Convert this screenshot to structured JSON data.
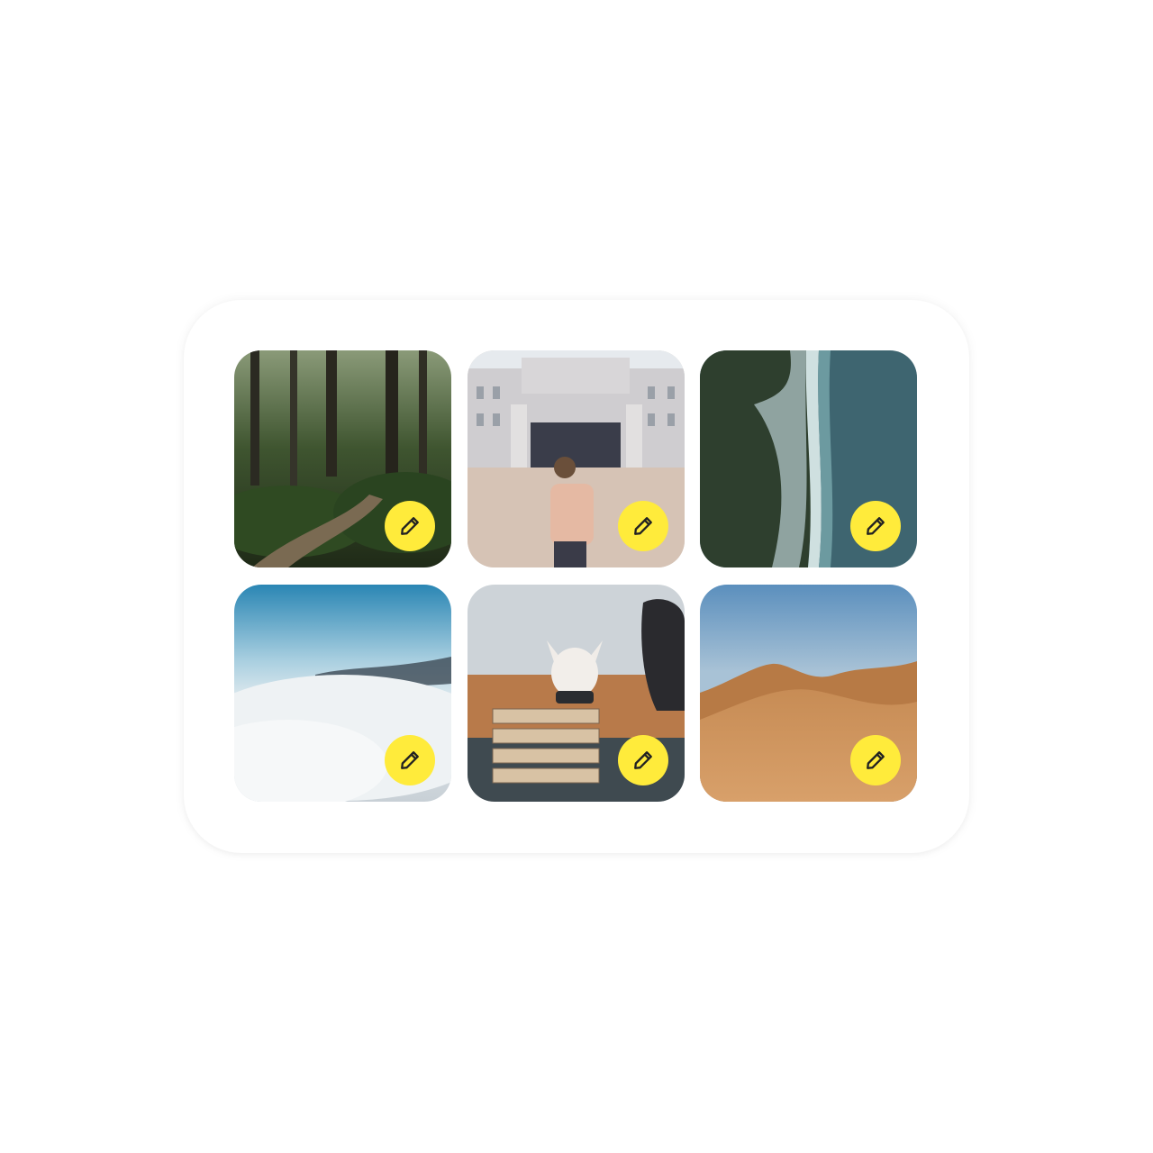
{
  "colors": {
    "edit_button_bg": "#FFEB3B",
    "edit_icon_stroke": "#222222",
    "card_bg": "#FFFFFF"
  },
  "gallery": {
    "tiles": [
      {
        "subject": "forest-trail",
        "edit_icon": "pencil-icon"
      },
      {
        "subject": "palace-visitor",
        "edit_icon": "pencil-icon"
      },
      {
        "subject": "aerial-coastline",
        "edit_icon": "pencil-icon"
      },
      {
        "subject": "sea-of-clouds",
        "edit_icon": "pencil-icon"
      },
      {
        "subject": "dog-in-basket",
        "edit_icon": "pencil-icon"
      },
      {
        "subject": "desert-dunes",
        "edit_icon": "pencil-icon"
      }
    ]
  }
}
